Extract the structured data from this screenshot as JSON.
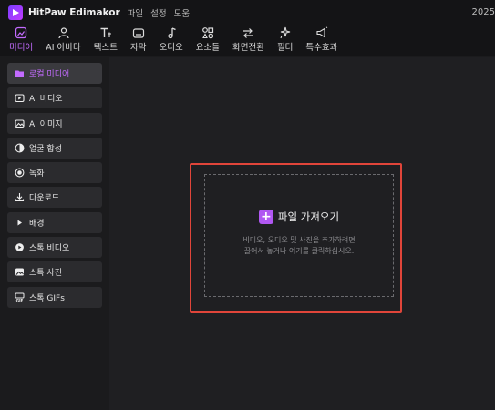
{
  "app": {
    "title": "HitPaw Edimakor",
    "year": "2025"
  },
  "menu": [
    "파일",
    "설정",
    "도움"
  ],
  "toolbar": [
    {
      "label": "미디어",
      "icon": "media-icon",
      "active": true
    },
    {
      "label": "AI 아바타",
      "icon": "avatar-icon"
    },
    {
      "label": "텍스트",
      "icon": "text-icon"
    },
    {
      "label": "자막",
      "icon": "subtitle-icon"
    },
    {
      "label": "오디오",
      "icon": "music-note-icon"
    },
    {
      "label": "요소들",
      "icon": "elements-icon"
    },
    {
      "label": "화면전환",
      "icon": "transition-arrows-icon"
    },
    {
      "label": "필터",
      "icon": "filter-sparkle-icon"
    },
    {
      "label": "특수효과",
      "icon": "effects-megaphone-icon"
    }
  ],
  "sidebar": [
    {
      "label": "로컬 미디어",
      "icon": "folder-icon",
      "active": true
    },
    {
      "label": "AI 비디오",
      "icon": "ai-video-icon"
    },
    {
      "label": "AI 이미지",
      "icon": "ai-image-icon"
    },
    {
      "label": "얼굴 합성",
      "icon": "face-swap-icon"
    },
    {
      "label": "녹화",
      "icon": "record-icon"
    },
    {
      "label": "다운로드",
      "icon": "download-icon"
    },
    {
      "label": "배경",
      "icon": "play-triangle-icon"
    },
    {
      "label": "스톡 비디오",
      "icon": "stock-video-icon"
    },
    {
      "label": "스톡 사진",
      "icon": "stock-photo-icon"
    },
    {
      "label": "스톡 GIFs",
      "icon": "gif-icon"
    }
  ],
  "dropzone": {
    "import_label": "파일 가져오기",
    "hint_line1": "비디오, 오디오 및 사진을 추가하려면",
    "hint_line2": "끌어서 놓거나 여기를 클릭하십시오."
  },
  "colors": {
    "accent": "#b057f2",
    "highlight": "#e0453a"
  }
}
